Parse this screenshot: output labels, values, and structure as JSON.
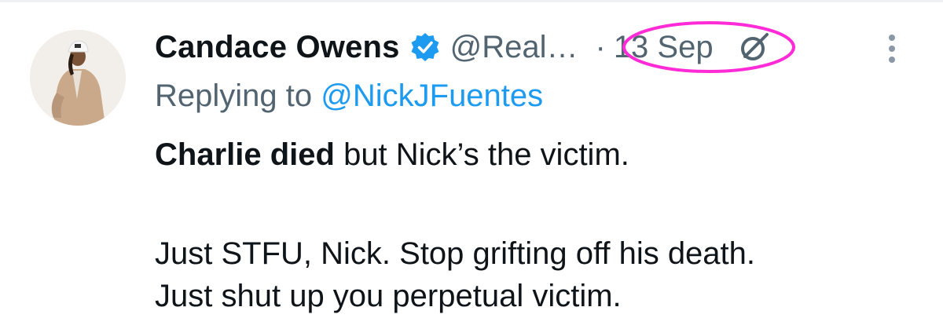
{
  "tweet": {
    "author_name": "Candace Owens",
    "handle": "@Real…",
    "separator": "·",
    "date": "13 Sep",
    "replying_prefix": "Replying to",
    "replying_to": "@NickJFuentes",
    "body_bold": "Charlie died",
    "body_line1_rest": " but Nick’s the victim.",
    "body_line2": "Just STFU, Nick. Stop grifting off his death.",
    "body_line3": "Just shut up you perpetual victim."
  },
  "icons": {
    "verified": "verified-badge-icon",
    "grok": "grok-icon",
    "more": "more-vertical-icon"
  },
  "colors": {
    "text": "#0f1419",
    "secondary": "#536471",
    "link": "#1d9bf0",
    "highlight": "#ff2bd6"
  }
}
